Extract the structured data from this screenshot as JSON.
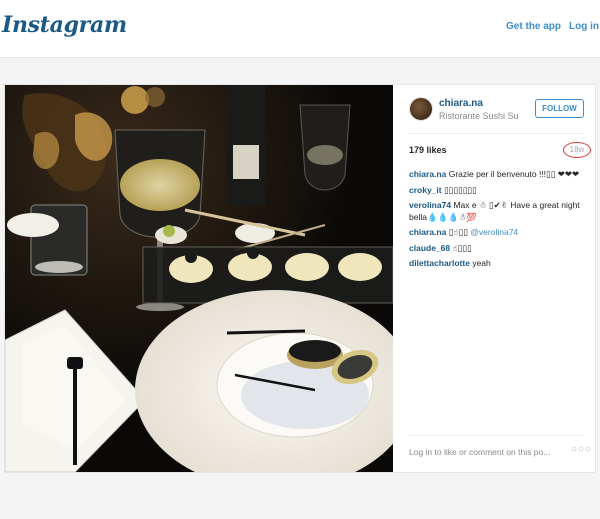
{
  "header": {
    "logo": "Instagram",
    "get_app": "Get the app",
    "login": "Log in"
  },
  "post": {
    "username": "chiara.na",
    "location": "Ristorante Sushi Su",
    "follow_label": "FOLLOW",
    "likes": "179 likes",
    "age": "18w",
    "photo_description_icon": "dinner-photo",
    "comments": [
      {
        "user": "chiara.na",
        "text": "Grazie per il benvenuto !!!▯▯ ❤❤❤"
      },
      {
        "user": "croky_it",
        "text": "▯▯▯▯▯▯▯"
      },
      {
        "user": "verolina74",
        "text": "Max e ☃ ▯✔✌ Have a great night bella💧💧💧☃💯"
      },
      {
        "user": "chiara.na",
        "text": "▯☝▯▯",
        "mention": "@verolina74"
      },
      {
        "user": "claude_68",
        "text": "☝▯▯▯"
      },
      {
        "user": "dilettacharlotte",
        "text": "yeah"
      }
    ],
    "login_prompt": "Log in to like or comment on this po...",
    "more_icon": "more-dots-icon"
  },
  "colors": {
    "brand_blue": "#3f8dcb",
    "username_blue": "#1c5a86",
    "highlight_red": "#d93a3a"
  }
}
